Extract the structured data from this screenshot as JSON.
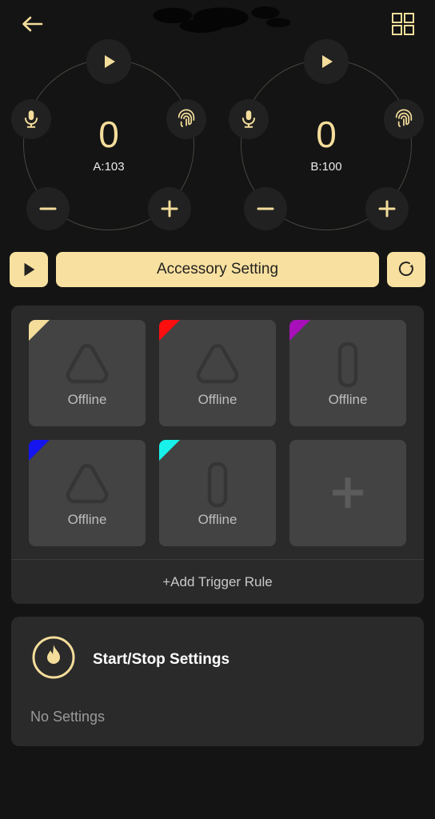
{
  "app": {
    "background_color": "#141414",
    "accent_color": "#F4DD9B",
    "button_color": "#F8E1A0"
  },
  "topbar": {
    "back_icon": "arrow-left-icon",
    "title": "",
    "title_state": "redacted",
    "grid_icon": "grid-view-icon"
  },
  "dials": [
    {
      "id": "dial-a",
      "value": "0",
      "label": "A:103",
      "play_icon": "play-icon",
      "mic_icon": "microphone-icon",
      "fingerprint_icon": "fingerprint-icon",
      "minus_icon": "minus-icon",
      "plus_icon": "plus-icon"
    },
    {
      "id": "dial-b",
      "value": "0",
      "label": "B:100",
      "play_icon": "play-icon",
      "mic_icon": "microphone-icon",
      "fingerprint_icon": "fingerprint-icon",
      "minus_icon": "minus-icon",
      "plus_icon": "plus-icon"
    }
  ],
  "action_row": {
    "play_icon": "play-icon",
    "accessory_setting_label": "Accessory Setting",
    "refresh_icon": "refresh-loop-icon"
  },
  "accessories": {
    "cards": [
      {
        "corner_color": "#F4DD9B",
        "device_type": "triangle",
        "status": "Offline"
      },
      {
        "corner_color": "#FF0E0E",
        "device_type": "triangle",
        "status": "Offline"
      },
      {
        "corner_color": "#A710B8",
        "device_type": "pill",
        "status": "Offline"
      },
      {
        "corner_color": "#1515F0",
        "device_type": "triangle",
        "status": "Offline"
      },
      {
        "corner_color": "#18F0EA",
        "device_type": "pill",
        "status": "Offline"
      }
    ],
    "add_card": {
      "icon": "plus-icon"
    },
    "trigger_rule_label": "+Add Trigger Rule"
  },
  "start_stop": {
    "icon": "flame-circle-icon",
    "title": "Start/Stop Settings",
    "subtitle": "No Settings"
  }
}
